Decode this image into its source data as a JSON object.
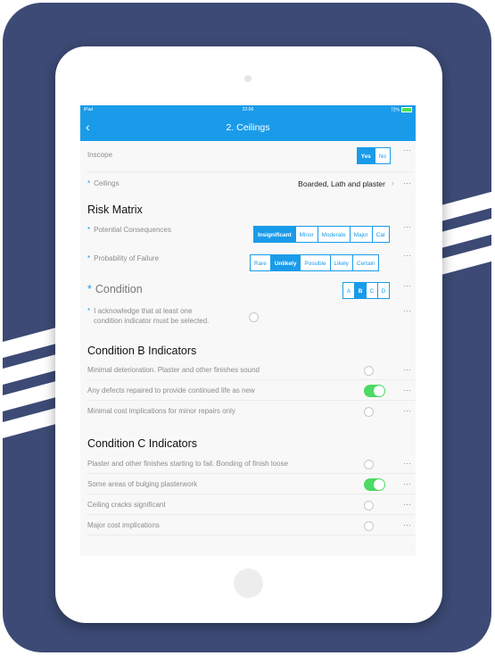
{
  "status_bar": {
    "carrier": "iPad",
    "time": "22:06",
    "battery": "72%"
  },
  "nav": {
    "title": "2. Ceilings"
  },
  "inscope": {
    "label": "Inscope",
    "options": [
      "Yes",
      "No"
    ],
    "selected": "Yes"
  },
  "ceilings": {
    "label": "Ceilings",
    "value": "Boarded, Lath and plaster"
  },
  "risk_matrix": {
    "title": "Risk Matrix",
    "consequences": {
      "label": "Potential Consequences",
      "options": [
        "Insignificant",
        "Minor",
        "Moderate",
        "Major",
        "Cat"
      ],
      "selected": "Insignificant"
    },
    "failure": {
      "label": "Probability of Failure",
      "options": [
        "Rare",
        "Unlikely",
        "Possible",
        "Likely",
        "Certain"
      ],
      "selected": "Unlikely"
    }
  },
  "condition": {
    "label": "Condition",
    "options": [
      "A",
      "B",
      "C",
      "D"
    ],
    "selected": "B"
  },
  "acknowledge": {
    "line1": "I acknowledge that at least one",
    "line2": "condition indicator must be selected."
  },
  "condition_b": {
    "title": "Condition B Indicators",
    "items": [
      {
        "text": "Minimal deterioration. Plaster and other finishes sound",
        "on": false
      },
      {
        "text": "Any defects repaired to provide continued life as new",
        "on": true
      },
      {
        "text": "Minimal cost implications for minor repairs only",
        "on": false
      }
    ]
  },
  "condition_c": {
    "title": "Condition C Indicators",
    "items": [
      {
        "text": "Plaster and other finishes starting to fail. Bonding of finish loose",
        "on": false
      },
      {
        "text": "Some areas of bulging plasterwork",
        "on": true
      },
      {
        "text": "Ceiling cracks significant",
        "on": false
      },
      {
        "text": "Major cost implications",
        "on": false
      }
    ]
  },
  "icons": {
    "more": "more-icon",
    "back": "back-icon",
    "chevron": "chevron-right-icon"
  },
  "colors": {
    "accent": "#1a9be9",
    "toggle_on": "#4cd964",
    "background_panel": "#3c4a75"
  }
}
